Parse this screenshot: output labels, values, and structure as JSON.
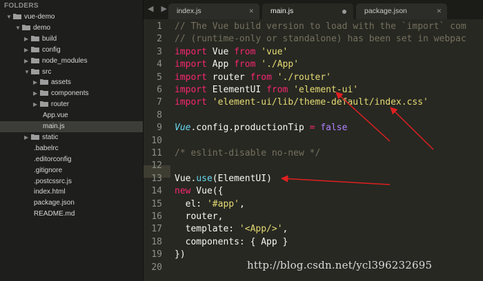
{
  "sidebar": {
    "title": "FOLDERS",
    "items": [
      {
        "label": "vue-demo",
        "type": "folder",
        "expanded": true,
        "depth": 0
      },
      {
        "label": "demo",
        "type": "folder",
        "expanded": true,
        "depth": 1
      },
      {
        "label": "build",
        "type": "folder",
        "expanded": false,
        "depth": 2
      },
      {
        "label": "config",
        "type": "folder",
        "expanded": false,
        "depth": 2
      },
      {
        "label": "node_modules",
        "type": "folder",
        "expanded": false,
        "depth": 2
      },
      {
        "label": "src",
        "type": "folder",
        "expanded": true,
        "depth": 2
      },
      {
        "label": "assets",
        "type": "folder",
        "expanded": false,
        "depth": 3
      },
      {
        "label": "components",
        "type": "folder",
        "expanded": false,
        "depth": 3
      },
      {
        "label": "router",
        "type": "folder",
        "expanded": false,
        "depth": 3
      },
      {
        "label": "App.vue",
        "type": "file",
        "depth": 3
      },
      {
        "label": "main.js",
        "type": "file",
        "depth": 3,
        "active": true
      },
      {
        "label": "static",
        "type": "folder",
        "expanded": false,
        "depth": 2
      },
      {
        "label": ".babelrc",
        "type": "file",
        "depth": 2
      },
      {
        "label": ".editorconfig",
        "type": "file",
        "depth": 2
      },
      {
        "label": ".gitignore",
        "type": "file",
        "depth": 2
      },
      {
        "label": ".postcssrc.js",
        "type": "file",
        "depth": 2
      },
      {
        "label": "index.html",
        "type": "file",
        "depth": 2
      },
      {
        "label": "package.json",
        "type": "file",
        "depth": 2
      },
      {
        "label": "README.md",
        "type": "file",
        "depth": 2
      }
    ]
  },
  "tabs": [
    {
      "label": "index.js",
      "state": "close"
    },
    {
      "label": "main.js",
      "state": "modified",
      "active": true
    },
    {
      "label": "package.json",
      "state": "close"
    }
  ],
  "nav": {
    "arrows": "◀ ▶"
  },
  "icons": {
    "close": "✕"
  },
  "editor": {
    "highlighted_line": 13,
    "lines": [
      {
        "n": "1",
        "tokens": [
          {
            "t": "// The Vue build version to load with the `import` com",
            "c": "comment"
          }
        ]
      },
      {
        "n": "2",
        "tokens": [
          {
            "t": "// (runtime-only or standalone) has been set in webpac",
            "c": "comment"
          }
        ]
      },
      {
        "n": "3",
        "tokens": [
          {
            "t": "import",
            "c": "kw"
          },
          {
            "t": " Vue ",
            "c": "plain"
          },
          {
            "t": "from",
            "c": "kw"
          },
          {
            "t": " ",
            "c": "plain"
          },
          {
            "t": "'vue'",
            "c": "str"
          }
        ]
      },
      {
        "n": "4",
        "tokens": [
          {
            "t": "import",
            "c": "kw"
          },
          {
            "t": " App ",
            "c": "plain"
          },
          {
            "t": "from",
            "c": "kw"
          },
          {
            "t": " ",
            "c": "plain"
          },
          {
            "t": "'./App'",
            "c": "str"
          }
        ]
      },
      {
        "n": "5",
        "tokens": [
          {
            "t": "import",
            "c": "kw"
          },
          {
            "t": " router ",
            "c": "plain"
          },
          {
            "t": "from",
            "c": "kw"
          },
          {
            "t": " ",
            "c": "plain"
          },
          {
            "t": "'./router'",
            "c": "str"
          }
        ]
      },
      {
        "n": "6",
        "tokens": [
          {
            "t": "import",
            "c": "kw"
          },
          {
            "t": " ElementUI ",
            "c": "plain"
          },
          {
            "t": "from",
            "c": "kw"
          },
          {
            "t": " ",
            "c": "plain"
          },
          {
            "t": "'element-ui'",
            "c": "str"
          }
        ]
      },
      {
        "n": "7",
        "tokens": [
          {
            "t": "import",
            "c": "kw"
          },
          {
            "t": " ",
            "c": "plain"
          },
          {
            "t": "'element-ui/lib/theme-default/index.css'",
            "c": "str"
          }
        ]
      },
      {
        "n": "8",
        "tokens": []
      },
      {
        "n": "9",
        "tokens": [
          {
            "t": "Vue",
            "c": "cls"
          },
          {
            "t": ".config.productionTip ",
            "c": "plain"
          },
          {
            "t": "=",
            "c": "kw"
          },
          {
            "t": " ",
            "c": "plain"
          },
          {
            "t": "false",
            "c": "num"
          }
        ]
      },
      {
        "n": "10",
        "tokens": []
      },
      {
        "n": "11",
        "tokens": [
          {
            "t": "/* eslint-disable no-new */",
            "c": "comment"
          }
        ]
      },
      {
        "n": "12",
        "tokens": []
      },
      {
        "n": "13",
        "tokens": [
          {
            "t": "Vue",
            "c": "plain"
          },
          {
            "t": ".",
            "c": "plain"
          },
          {
            "t": "use",
            "c": "fn"
          },
          {
            "t": "(ElementUI)",
            "c": "plain"
          }
        ]
      },
      {
        "n": "14",
        "tokens": [
          {
            "t": "new",
            "c": "kw"
          },
          {
            "t": " Vue({",
            "c": "plain"
          }
        ]
      },
      {
        "n": "15",
        "tokens": [
          {
            "t": "  el: ",
            "c": "plain"
          },
          {
            "t": "'#app'",
            "c": "str"
          },
          {
            "t": ",",
            "c": "plain"
          }
        ]
      },
      {
        "n": "16",
        "tokens": [
          {
            "t": "  router,",
            "c": "plain"
          }
        ]
      },
      {
        "n": "17",
        "tokens": [
          {
            "t": "  template: ",
            "c": "plain"
          },
          {
            "t": "'<App/>'",
            "c": "str"
          },
          {
            "t": ",",
            "c": "plain"
          }
        ]
      },
      {
        "n": "18",
        "tokens": [
          {
            "t": "  components: { App }",
            "c": "plain"
          }
        ]
      },
      {
        "n": "19",
        "tokens": [
          {
            "t": "})",
            "c": "plain"
          }
        ]
      },
      {
        "n": "20",
        "tokens": []
      }
    ]
  },
  "watermark": "http://blog.csdn.net/ycl396232695",
  "colors": {
    "annotation": "#e02020",
    "folder": "#9d9d9d"
  }
}
